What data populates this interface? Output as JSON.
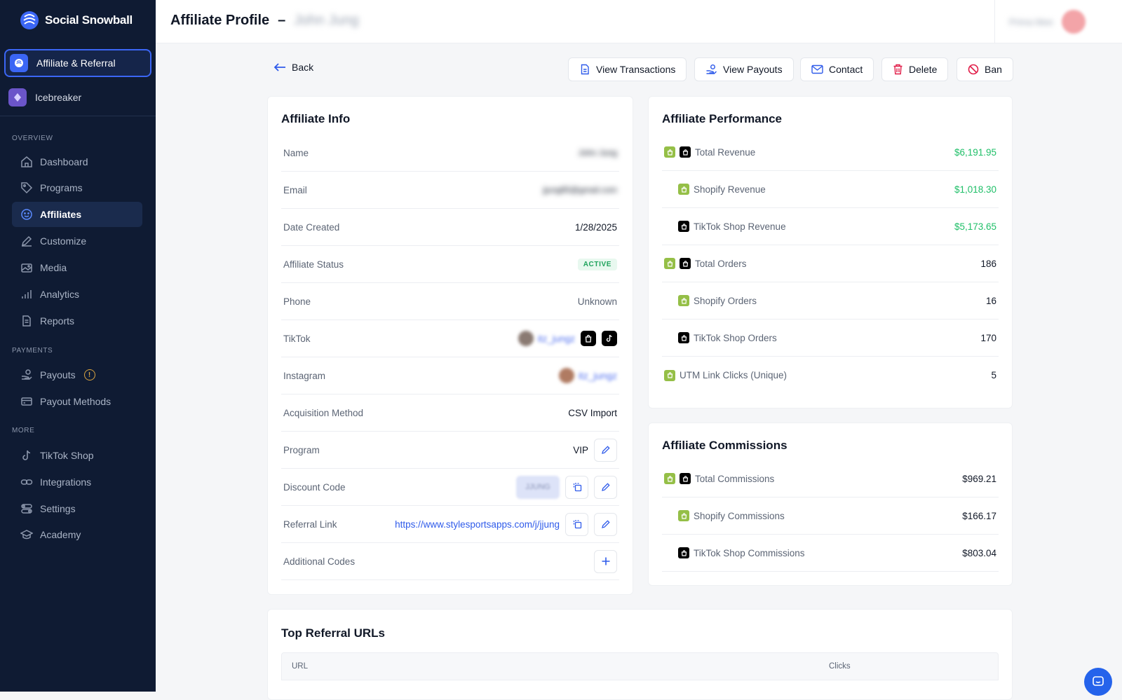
{
  "sidebar": {
    "brand": "Social Snowball",
    "workspaces": [
      {
        "label": "Affiliate & Referral",
        "active": true
      },
      {
        "label": "Icebreaker",
        "active": false
      }
    ],
    "sections": {
      "overview": "OVERVIEW",
      "payments": "PAYMENTS",
      "more": "MORE"
    },
    "items": {
      "dashboard": "Dashboard",
      "programs": "Programs",
      "affiliates": "Affiliates",
      "customize": "Customize",
      "media": "Media",
      "analytics": "Analytics",
      "reports": "Reports",
      "payouts": "Payouts",
      "payout_methods": "Payout Methods",
      "tiktok_shop": "TikTok Shop",
      "integrations": "Integrations",
      "settings": "Settings",
      "academy": "Academy"
    },
    "payouts_badge": "!"
  },
  "header": {
    "title": "Affiliate Profile",
    "dash": "–",
    "affiliate_name": "John Jung",
    "user_name": "Prima Mee"
  },
  "actions": {
    "back": "Back",
    "view_transactions": "View Transactions",
    "view_payouts": "View Payouts",
    "contact": "Contact",
    "delete": "Delete",
    "ban": "Ban"
  },
  "affiliate_info": {
    "title": "Affiliate Info",
    "name_label": "Name",
    "name_value": "John Jung",
    "email_label": "Email",
    "email_value": "jjung85@gmail.com",
    "date_label": "Date Created",
    "date_value": "1/28/2025",
    "status_label": "Affiliate Status",
    "status_value": "ACTIVE",
    "phone_label": "Phone",
    "phone_value": "Unknown",
    "tiktok_label": "TikTok",
    "tiktok_handle": "itz_jungz",
    "instagram_label": "Instagram",
    "instagram_handle": "itz_jungz",
    "acquisition_label": "Acquisition Method",
    "acquisition_value": "CSV Import",
    "program_label": "Program",
    "program_value": "VIP",
    "discount_label": "Discount Code",
    "discount_value": "JJUNG",
    "referral_label": "Referral Link",
    "referral_value": "https://www.stylesportsapps.com/j/jjung",
    "additional_label": "Additional Codes"
  },
  "performance": {
    "title": "Affiliate Performance",
    "rows": [
      {
        "label": "Total Revenue",
        "value": "$6,191.95"
      },
      {
        "label": "Shopify Revenue",
        "value": "$1,018.30"
      },
      {
        "label": "TikTok Shop Revenue",
        "value": "$5,173.65"
      },
      {
        "label": "Total Orders",
        "value": "186"
      },
      {
        "label": "Shopify Orders",
        "value": "16"
      },
      {
        "label": "TikTok Shop Orders",
        "value": "170"
      },
      {
        "label": "UTM Link Clicks (Unique)",
        "value": "5"
      }
    ]
  },
  "commissions": {
    "title": "Affiliate Commissions",
    "rows": [
      {
        "label": "Total Commissions",
        "value": "$969.21"
      },
      {
        "label": "Shopify Commissions",
        "value": "$166.17"
      },
      {
        "label": "TikTok Shop Commissions",
        "value": "$803.04"
      }
    ]
  },
  "referral_urls": {
    "title": "Top Referral URLs",
    "col_url": "URL",
    "col_clicks": "Clicks"
  },
  "colors": {
    "sidebar_bg": "#0f1b33",
    "accent": "#3b66f5",
    "positive": "#1fbf68",
    "danger": "#e11d48",
    "shopify": "#95bf47"
  }
}
